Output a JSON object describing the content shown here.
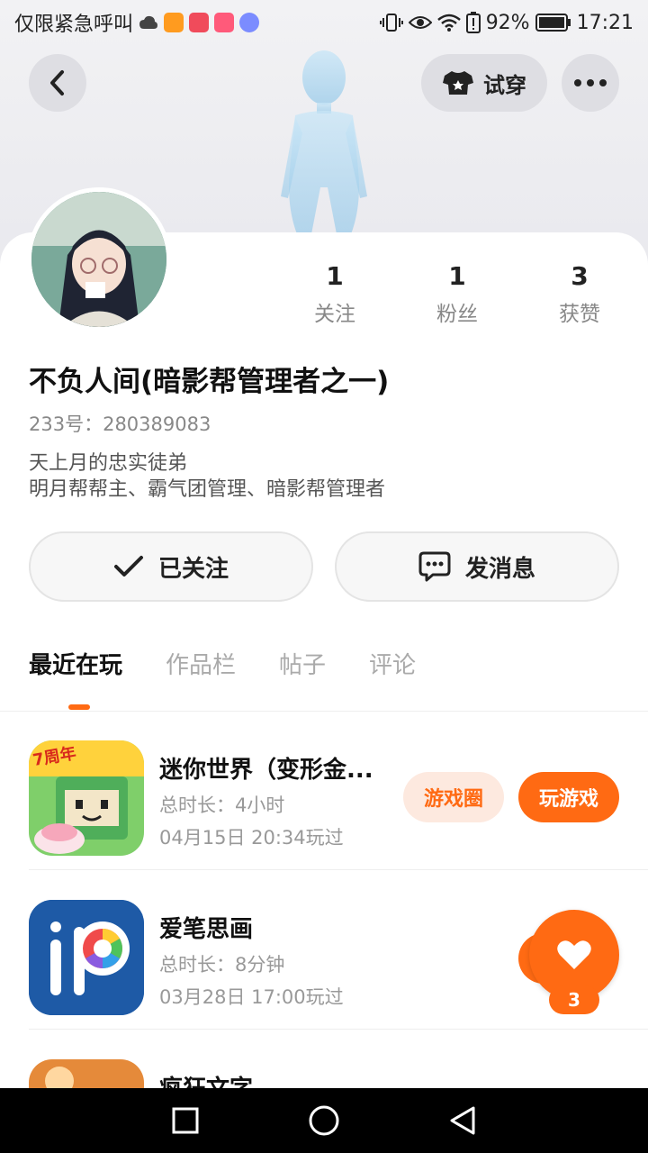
{
  "status_bar": {
    "carrier": "仅限紧急呼叫",
    "battery": "92%",
    "time": "17:21"
  },
  "header": {
    "try_on_label": "试穿"
  },
  "profile": {
    "stats": [
      {
        "value": "1",
        "label": "关注"
      },
      {
        "value": "1",
        "label": "粉丝"
      },
      {
        "value": "3",
        "label": "获赞"
      }
    ],
    "username": "不负人间(暗影帮管理者之一)",
    "uid": "233号：280389083",
    "bio_line1": "天上月的忠实徒弟",
    "bio_line2": "明月帮帮主、霸气团管理、暗影帮管理者",
    "follow_label": "已关注",
    "message_label": "发消息"
  },
  "tabs": [
    "最近在玩",
    "作品栏",
    "帖子",
    "评论"
  ],
  "games": [
    {
      "name": "迷你世界（变形金...",
      "duration": "总时长：4小时",
      "last_played": "04月15日 20:34玩过",
      "circle_label": "游戏圈",
      "play_label": "玩游戏",
      "icon_badge": "7周年"
    },
    {
      "name": "爱笔思画",
      "duration": "总时长：8分钟",
      "last_played": "03月28日 17:00玩过"
    },
    {
      "name": "疯狂文字"
    }
  ],
  "like_count": "3",
  "colors": {
    "accent": "#ff6a13",
    "accent_light": "#fde9df"
  }
}
